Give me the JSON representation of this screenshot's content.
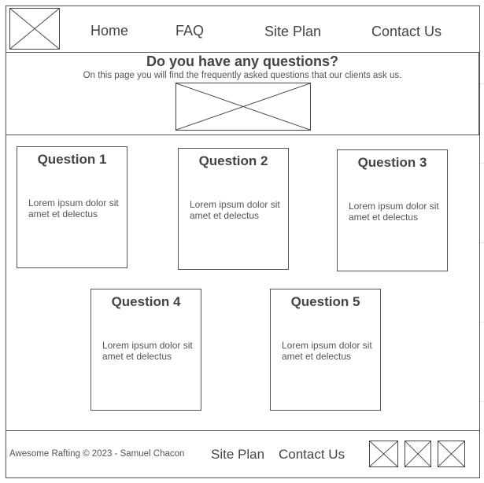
{
  "header": {
    "nav": [
      "Home",
      "FAQ",
      "Site Plan",
      "Contact Us"
    ]
  },
  "hero": {
    "title": "Do you have any questions?",
    "subtitle": "On this page you will find the frequently asked questions that our clients ask us."
  },
  "questions": [
    {
      "title": "Question 1",
      "body": "Lorem ipsum dolor sit amet et delectus"
    },
    {
      "title": "Question 2",
      "body": "Lorem ipsum dolor sit amet et delectus"
    },
    {
      "title": "Question 3",
      "body": "Lorem ipsum dolor sit amet et delectus"
    },
    {
      "title": "Question 4",
      "body": "Lorem ipsum dolor sit amet et delectus"
    },
    {
      "title": "Question 5",
      "body": "Lorem ipsum dolor sit amet et delectus"
    }
  ],
  "footer": {
    "copyright": "Awesome Rafting © 2023 - Samuel Chacon",
    "links": [
      "Site Plan",
      "Contact Us"
    ]
  }
}
